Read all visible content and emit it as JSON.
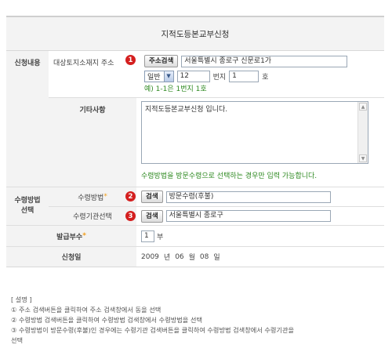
{
  "form": {
    "title": "지적도등본교부신청",
    "apply_section": {
      "label": "신청내용",
      "address": {
        "label": "대상토지소재지 주소",
        "step": "1",
        "search_button": "주소검색",
        "value": "서울특별시 종로구 신문로1가",
        "land_type": "일반",
        "main_no": "12",
        "sub_label": "번지",
        "sub_no": "1",
        "ho_label": "호",
        "example": "예) 1-1은 1번지 1호"
      },
      "remarks": {
        "label": "기타사항",
        "value": "지적도등본교부신청 입니다.",
        "hint": "수령방법을 방문수령으로 선택하는 경우만 입력 가능합니다."
      }
    },
    "receive_section": {
      "label_line1": "수령방법",
      "label_line2": "선택",
      "method": {
        "label": "수령방법",
        "required_mark": "*",
        "step": "2",
        "button": "검색",
        "value": "방문수령(후불)"
      },
      "agency": {
        "label": "수령기관선택",
        "step": "3",
        "button": "검색",
        "value": "서울특별시 종로구"
      }
    },
    "copies": {
      "label": "발급부수",
      "required_mark": "*",
      "value": "1",
      "unit": "부"
    },
    "apply_date": {
      "label": "신청일",
      "year": "2009",
      "year_unit": "년",
      "month": "06",
      "month_unit": "월",
      "day": "08",
      "day_unit": "일"
    }
  },
  "notes": {
    "heading": "[ 설명 ]",
    "line1": "① 주소 검색버튼을 클릭하여 주소 검색창에서 동을 선택",
    "line2": "② 수령방법 검색버튼을 클릭하여 수령방법 검색창에서 수령방법을 선택",
    "line3": "③ 수령방법이 방문수령(후불)인 경우에는 수령기관 검색버튼을 클릭하여 수령방법 검색창에서 수령기관을",
    "line4": "선택"
  },
  "colors": {
    "label_bg": "#f3f3f3",
    "step_badge": "#d41f1f",
    "hint_green": "#2f8a22",
    "required_orange": "#f29e1b"
  }
}
